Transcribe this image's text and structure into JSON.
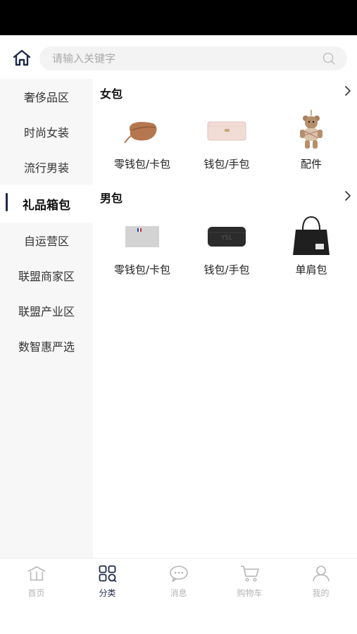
{
  "search": {
    "placeholder": "请输入关键字"
  },
  "sidebar": {
    "items": [
      {
        "label": "奢侈品区",
        "active": false
      },
      {
        "label": "时尚女装",
        "active": false
      },
      {
        "label": "流行男装",
        "active": false
      },
      {
        "label": "礼品箱包",
        "active": true
      },
      {
        "label": "自运营区",
        "active": false
      },
      {
        "label": "联盟商家区",
        "active": false
      },
      {
        "label": "联盟产业区",
        "active": false
      },
      {
        "label": "数智惠严选",
        "active": false
      }
    ]
  },
  "sections": [
    {
      "title": "女包",
      "items": [
        {
          "label": "零钱包/卡包",
          "icon": "coin-purse-image"
        },
        {
          "label": "钱包/手包",
          "icon": "pink-wallet-image"
        },
        {
          "label": "配件",
          "icon": "teddy-bear-charm-image"
        }
      ]
    },
    {
      "title": "男包",
      "items": [
        {
          "label": "零钱包/卡包",
          "icon": "card-holder-image"
        },
        {
          "label": "钱包/手包",
          "icon": "black-wallet-image"
        },
        {
          "label": "单肩包",
          "icon": "tote-bag-image"
        }
      ]
    }
  ],
  "tabbar": {
    "tabs": [
      {
        "label": "首页",
        "icon": "home-icon",
        "active": false
      },
      {
        "label": "分类",
        "icon": "category-icon",
        "active": true
      },
      {
        "label": "消息",
        "icon": "message-icon",
        "active": false
      },
      {
        "label": "购物车",
        "icon": "cart-icon",
        "active": false
      },
      {
        "label": "我的",
        "icon": "user-icon",
        "active": false
      }
    ]
  },
  "colors": {
    "accent": "#1f2a4a",
    "inactive": "#b5b5b5",
    "sidebar_bg": "#f7f7f7"
  }
}
